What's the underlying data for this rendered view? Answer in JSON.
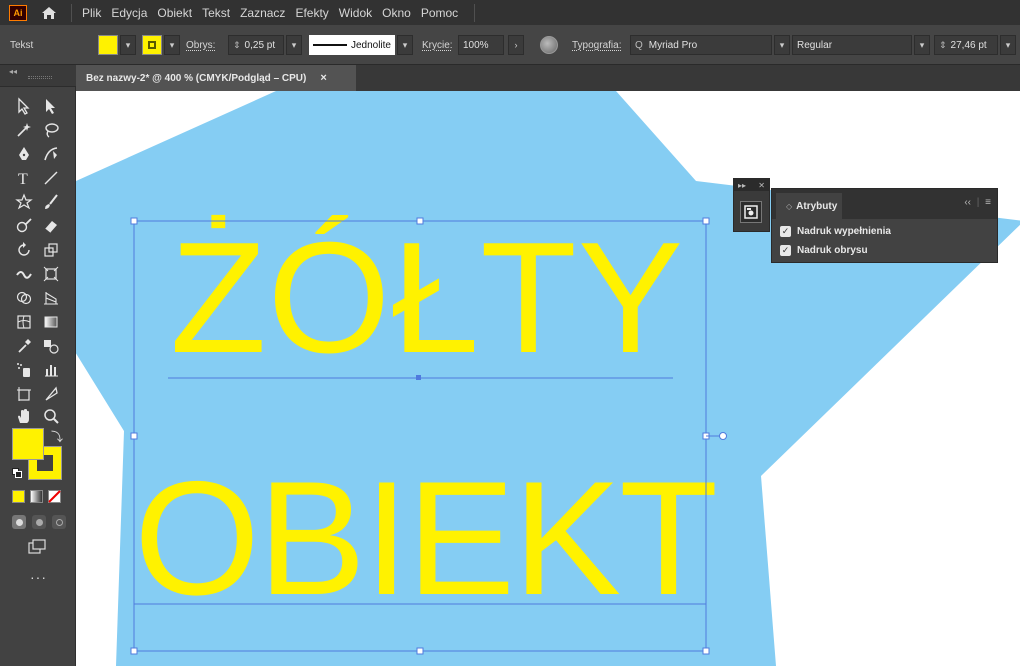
{
  "app": {
    "logo": "Ai"
  },
  "menu": [
    "Plik",
    "Edycja",
    "Obiekt",
    "Tekst",
    "Zaznacz",
    "Efekty",
    "Widok",
    "Okno",
    "Pomoc"
  ],
  "control_bar": {
    "mode_label": "Tekst",
    "stroke_label": "Obrys:",
    "stroke_weight": "0,25 pt",
    "profile_label": "Jednolite",
    "opacity_label": "Krycie:",
    "opacity_value": "100%",
    "typography_label": "Typografia:",
    "font_family": "Myriad Pro",
    "font_style": "Regular",
    "font_size": "27,46 pt"
  },
  "document": {
    "tab_title": "Bez nazwy-2* @ 400 % (CMYK/Podgląd – CPU)",
    "close_glyph": "×",
    "text_line1": "ŻÓŁTY",
    "text_line2": "OBIEKT"
  },
  "attributes_panel": {
    "title": "Atrybuty",
    "collapse_glyph": "‹‹",
    "menu_glyph": "≡",
    "mini_arrows": "▸▸",
    "mini_close": "✕",
    "items": [
      {
        "label": "Nadruk wypełnienia",
        "checked": true
      },
      {
        "label": "Nadruk obrysu",
        "checked": true
      }
    ]
  },
  "toolbar": {
    "more_label": "···"
  },
  "colors": {
    "fill": "#fff200",
    "star": "#85cdf3",
    "selection": "#4f7bde",
    "menubar": "#323232",
    "panel": "#424242"
  },
  "icons": {
    "home": "home-icon",
    "globe": "recolor-globe-icon",
    "search": "font-search-icon",
    "attributes": "attributes-icon"
  }
}
